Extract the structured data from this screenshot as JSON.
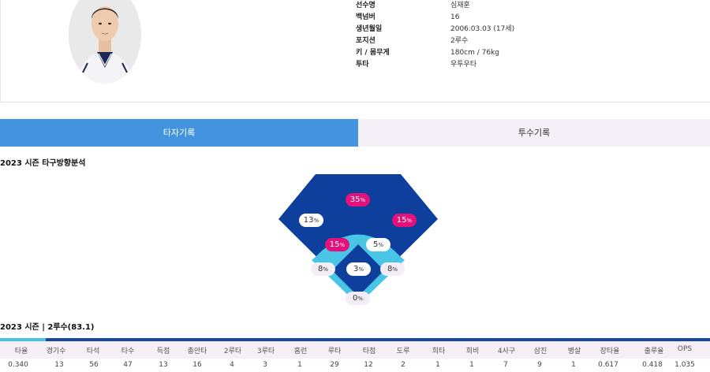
{
  "profile": {
    "photo_alt": "선수 사진",
    "fields": [
      {
        "label": "선수명",
        "value": "심재훈"
      },
      {
        "label": "백넘버",
        "value": "16"
      },
      {
        "label": "생년월일",
        "value": "2006.03.03 (17세)"
      },
      {
        "label": "포지션",
        "value": "2루수"
      },
      {
        "label": "키 / 몸무게",
        "value": "180cm / 76kg"
      },
      {
        "label": "투타",
        "value": "우투우타"
      }
    ]
  },
  "tabs": [
    {
      "label": "타자기록",
      "active": true
    },
    {
      "label": "투수기록",
      "active": false
    }
  ],
  "spray": {
    "title": "2023 시즌 타구방향분석",
    "unit": "%",
    "zones": [
      {
        "id": "center-deep",
        "value": "35",
        "tone": "hot"
      },
      {
        "id": "left-deep",
        "value": "13",
        "tone": "cool"
      },
      {
        "id": "right-deep",
        "value": "15",
        "tone": "hot"
      },
      {
        "id": "left-infield",
        "value": "15",
        "tone": "hot"
      },
      {
        "id": "right-infield",
        "value": "5",
        "tone": "cool"
      },
      {
        "id": "third-line",
        "value": "8",
        "tone": "pale"
      },
      {
        "id": "middle",
        "value": "3",
        "tone": "cool"
      },
      {
        "id": "first-line",
        "value": "8",
        "tone": "pale"
      },
      {
        "id": "catcher",
        "value": "0",
        "tone": "pale"
      }
    ],
    "colors": {
      "outfield": "#0f3f9c",
      "infield": "#49c6e6",
      "hot": "#e3117a"
    }
  },
  "season": {
    "title": "2023 시즌 | 2루수(83.1)",
    "headers": [
      "타율",
      "경기수",
      "타석",
      "타수",
      "득점",
      "총안타",
      "2루타",
      "3루타",
      "홈런",
      "루타",
      "타점",
      "도루",
      "희타",
      "희비",
      "4사구",
      "삼진",
      "병살",
      "장타율",
      "출루율",
      "OPS"
    ],
    "values": [
      "0.340",
      "13",
      "56",
      "47",
      "13",
      "16",
      "4",
      "3",
      "1",
      "29",
      "12",
      "2",
      "1",
      "1",
      "7",
      "9",
      "1",
      "0.617",
      "0.418",
      "1.035"
    ]
  }
}
